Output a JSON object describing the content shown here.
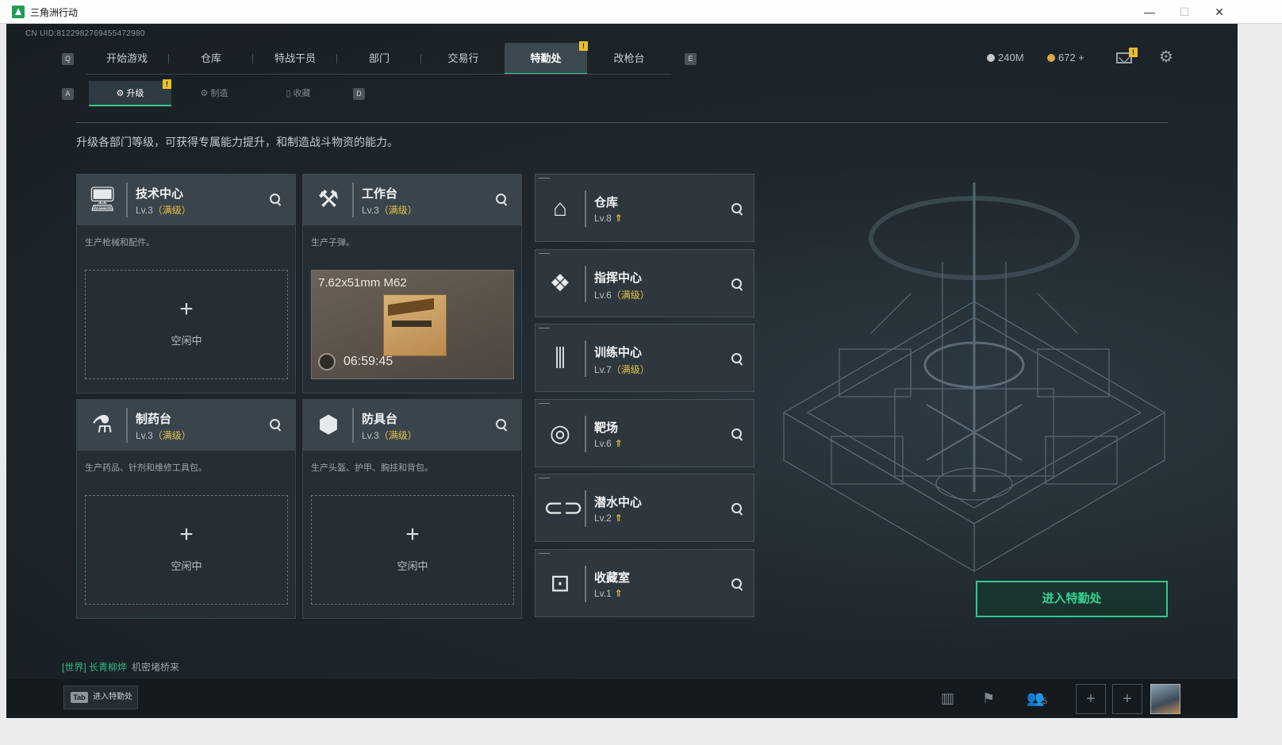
{
  "window": {
    "title": "三角洲行动",
    "minimize": "—",
    "maximize": "☐",
    "close": "✕"
  },
  "uid": "CN UID:8122982769455472980",
  "nav": {
    "key_left": "Q",
    "key_right": "E",
    "tabs": [
      "开始游戏",
      "仓库",
      "特战干员",
      "部门",
      "交易行",
      "特勤处",
      "改枪台"
    ],
    "active_index": 5,
    "badge": "!"
  },
  "currency": {
    "coins": "240M",
    "gems": "672 +"
  },
  "mail_badge": "!",
  "subnav": {
    "key_left": "A",
    "key_right": "D",
    "tabs": [
      "升级",
      "制造",
      "收藏"
    ],
    "active_index": 0,
    "badge": "!"
  },
  "description": "升级各部门等级，可获得专属能力提升，和制造战斗物资的能力。",
  "production": [
    {
      "icon": "monitor-icon",
      "name": "技术中心",
      "lv": "Lv.3",
      "max": "（满级）",
      "desc": "生产枪械和配件。",
      "slot": {
        "plus": "+",
        "idle": "空闲中"
      }
    },
    {
      "icon": "hammer-icon",
      "name": "工作台",
      "lv": "Lv.3",
      "max": "（满级）",
      "desc": "生产子弹。",
      "item": {
        "name": "7.62x51mm M62",
        "timer": "06:59:45"
      }
    },
    {
      "icon": "medicine-icon",
      "name": "制药台",
      "lv": "Lv.3",
      "max": "（满级）",
      "desc": "生产药品、针剂和维修工具包。",
      "slot": {
        "plus": "+",
        "idle": "空闲中"
      }
    },
    {
      "icon": "armor-icon",
      "name": "防具台",
      "lv": "Lv.3",
      "max": "（满级）",
      "desc": "生产头盔、护甲、胸挂和背包。",
      "slot": {
        "plus": "+",
        "idle": "空闲中"
      }
    }
  ],
  "facilities": [
    {
      "icon": "warehouse-icon",
      "name": "仓库",
      "lv": "Lv.8",
      "max": "",
      "up": "⇑"
    },
    {
      "icon": "command-icon",
      "name": "指挥中心",
      "lv": "Lv.6",
      "max": "（满级）",
      "up": ""
    },
    {
      "icon": "dumbbell-icon",
      "name": "训练中心",
      "lv": "Lv.7",
      "max": "（满级）",
      "up": ""
    },
    {
      "icon": "target-icon",
      "name": "靶场",
      "lv": "Lv.6",
      "max": "",
      "up": "⇑"
    },
    {
      "icon": "diving-mask-icon",
      "name": "潜水中心",
      "lv": "Lv.2",
      "max": "",
      "up": "⇑"
    },
    {
      "icon": "vault-icon",
      "name": "收藏室",
      "lv": "Lv.1",
      "max": "",
      "up": "⇑"
    }
  ],
  "enter_button": "进入特勤处",
  "chat": {
    "channel": "[世界]",
    "user": "长青柳烨",
    "message": "机密堵桥来"
  },
  "bottom": {
    "tab_key": "Tab",
    "tab_label": "进入特勤处",
    "team_count": "5",
    "plus": "+"
  },
  "colors": {
    "accent": "#34c98c",
    "max_level": "#e3c24a",
    "panel": "#262e35"
  }
}
